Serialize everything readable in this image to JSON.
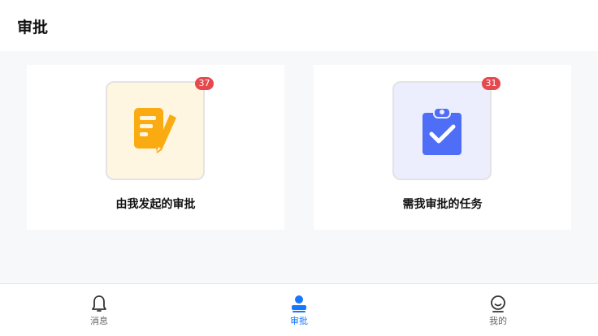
{
  "header": {
    "title": "审批"
  },
  "cards": [
    {
      "label": "由我发起的审批",
      "badge": "37",
      "icon": "document-edit-icon",
      "icon_color": "#fbab12",
      "bg": "#fff6e2"
    },
    {
      "label": "需我审批的任务",
      "badge": "31",
      "icon": "clipboard-check-icon",
      "icon_color": "#4f6ef7",
      "bg": "#eceefe"
    }
  ],
  "tabbar": {
    "tabs": [
      {
        "label": "消息",
        "icon": "bell-icon",
        "active": false
      },
      {
        "label": "审批",
        "icon": "user-stamp-icon",
        "active": true
      },
      {
        "label": "我的",
        "icon": "smile-face-icon",
        "active": false
      }
    ]
  },
  "colors": {
    "accent": "#1677ff",
    "badge": "#e5484d"
  }
}
